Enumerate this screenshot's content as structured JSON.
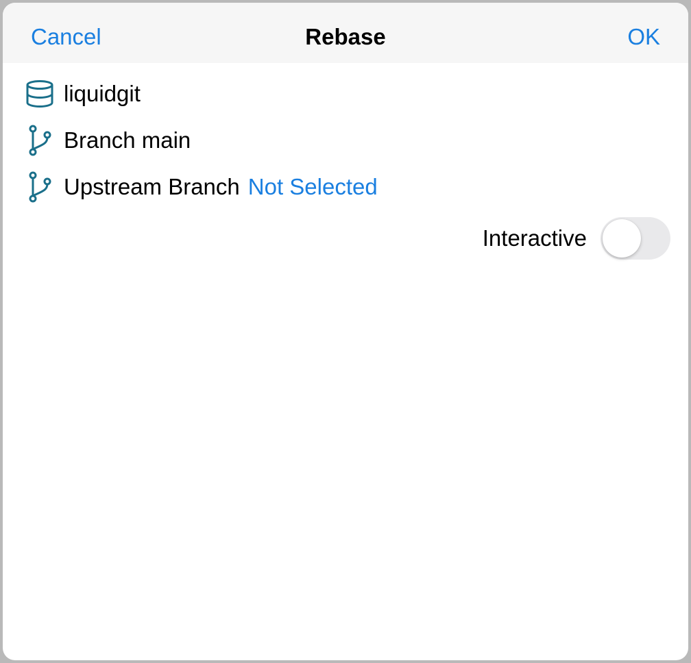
{
  "navbar": {
    "cancel_label": "Cancel",
    "title": "Rebase",
    "ok_label": "OK"
  },
  "repository": {
    "icon": "database-icon",
    "name": "liquidgit"
  },
  "branch": {
    "icon": "git-branch-icon",
    "label": "Branch main"
  },
  "upstream": {
    "icon": "git-branch-icon",
    "label": "Upstream Branch",
    "value": "Not Selected"
  },
  "interactive": {
    "label": "Interactive",
    "enabled": false
  },
  "colors": {
    "accent": "#1a7fe0",
    "icon": "#1a6f8a",
    "navbar_bg": "#f6f6f6",
    "toggle_off": "#e9e9eb"
  }
}
